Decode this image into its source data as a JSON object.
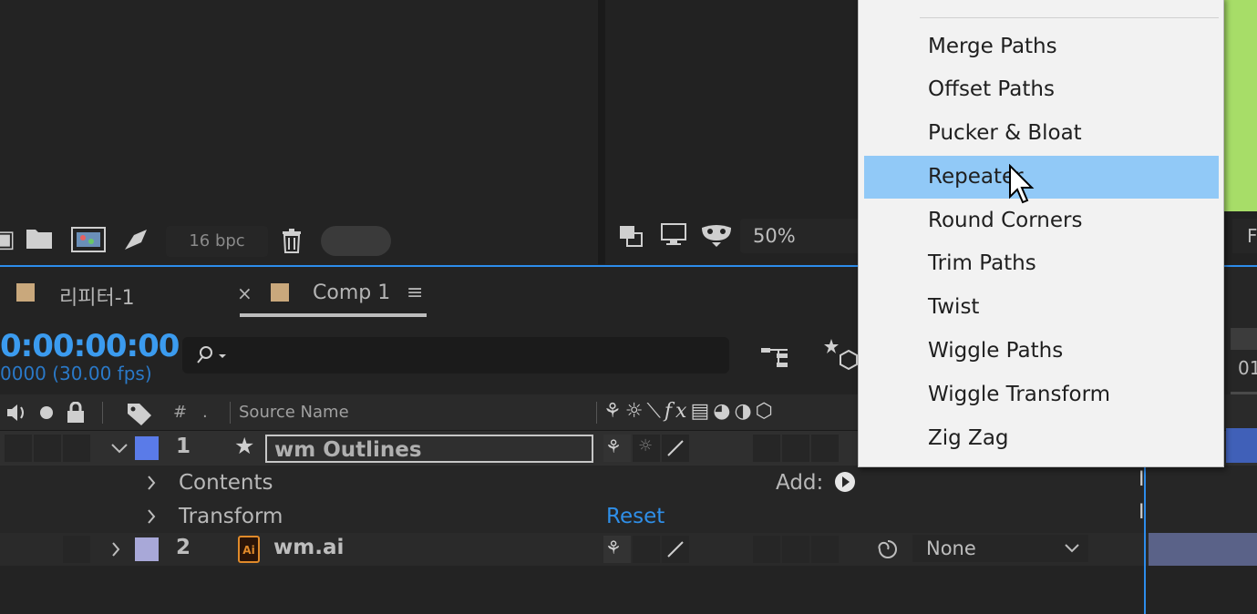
{
  "project_panel": {
    "bpc": "16 bpc"
  },
  "viewer": {
    "zoom": "50%",
    "right_partial": "F"
  },
  "timeline": {
    "tabs": [
      {
        "label": "리피터-1",
        "color": "#c9a87c"
      },
      {
        "label": "Comp 1",
        "color": "#c9a87c",
        "close": "×",
        "menu": "≡"
      }
    ],
    "timecode": "0:00:00:00",
    "fps": "0000 (30.00 fps)",
    "columns": {
      "hash": "#",
      "dot": ".",
      "source_name": "Source Name"
    },
    "right_partial": "01"
  },
  "layers": [
    {
      "number": "1",
      "name": "wm Outlines",
      "label_color": "#5a7be8",
      "children": [
        {
          "name": "Contents",
          "add_label": "Add:"
        },
        {
          "name": "Transform",
          "action": "Reset"
        }
      ]
    },
    {
      "number": "2",
      "name": "wm.ai",
      "label_color": "#a8a8d8",
      "parent": "None"
    }
  ],
  "context_menu": {
    "items": [
      {
        "label": "Merge Paths",
        "active": false
      },
      {
        "label": "Offset Paths",
        "active": false
      },
      {
        "label": "Pucker & Bloat",
        "active": false
      },
      {
        "label": "Repeater",
        "active": true
      },
      {
        "label": "Round Corners",
        "active": false
      },
      {
        "label": "Trim Paths",
        "active": false
      },
      {
        "label": "Twist",
        "active": false
      },
      {
        "label": "Wiggle Paths",
        "active": false
      },
      {
        "label": "Wiggle Transform",
        "active": false
      },
      {
        "label": "Zig Zag",
        "active": false
      }
    ]
  },
  "colors": {
    "accent_blue": "#2d8ceb",
    "menu_highlight": "#91c9f7",
    "viewer_green": "#a7dd68"
  }
}
